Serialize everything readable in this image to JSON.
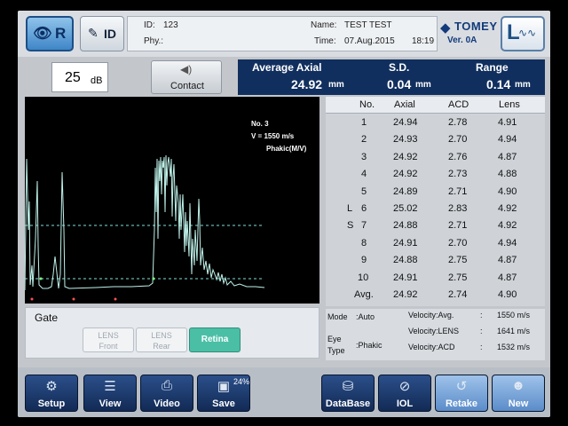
{
  "header": {
    "eye_side": "R",
    "id_button": "ID",
    "id_label": "ID:",
    "id_value": "123",
    "phy_label": "Phy.:",
    "phy_value": "",
    "name_label": "Name:",
    "name_value": "TEST TEST",
    "time_label": "Time:",
    "time_value": "07.Aug.2015",
    "time_clock": "18:19",
    "brand": "TOMEY",
    "version": "Ver. 0A",
    "lens_mode": "L"
  },
  "gain": {
    "value": "25",
    "unit": "dB"
  },
  "contact": {
    "label": "Contact"
  },
  "summary": {
    "avg_label": "Average Axial",
    "avg_value": "24.92",
    "avg_unit": "mm",
    "sd_label": "S.D.",
    "sd_value": "0.04",
    "sd_unit": "mm",
    "range_label": "Range",
    "range_value": "0.14",
    "range_unit": "mm"
  },
  "waveform_info": {
    "no": "No. 3",
    "velocity": "V = 1550 m/s",
    "phakic": "Phakic(M/V)"
  },
  "table": {
    "headers": [
      "No.",
      "Axial",
      "ACD",
      "Lens"
    ],
    "rows": [
      {
        "mark": "",
        "no": "1",
        "axial": "24.94",
        "acd": "2.78",
        "lens": "4.91"
      },
      {
        "mark": "",
        "no": "2",
        "axial": "24.93",
        "acd": "2.70",
        "lens": "4.94"
      },
      {
        "mark": "",
        "no": "3",
        "axial": "24.92",
        "acd": "2.76",
        "lens": "4.87"
      },
      {
        "mark": "",
        "no": "4",
        "axial": "24.92",
        "acd": "2.73",
        "lens": "4.88"
      },
      {
        "mark": "",
        "no": "5",
        "axial": "24.89",
        "acd": "2.71",
        "lens": "4.90"
      },
      {
        "mark": "L",
        "no": "6",
        "axial": "25.02",
        "acd": "2.83",
        "lens": "4.92"
      },
      {
        "mark": "S",
        "no": "7",
        "axial": "24.88",
        "acd": "2.71",
        "lens": "4.92"
      },
      {
        "mark": "",
        "no": "8",
        "axial": "24.91",
        "acd": "2.70",
        "lens": "4.94"
      },
      {
        "mark": "",
        "no": "9",
        "axial": "24.88",
        "acd": "2.75",
        "lens": "4.87"
      },
      {
        "mark": "",
        "no": "10",
        "axial": "24.91",
        "acd": "2.75",
        "lens": "4.87"
      },
      {
        "mark": "",
        "no": "Avg.",
        "axial": "24.92",
        "acd": "2.74",
        "lens": "4.90"
      }
    ]
  },
  "gate": {
    "title": "Gate",
    "buttons": [
      {
        "line1": "LENS",
        "line2": "Front"
      },
      {
        "line1": "LENS",
        "line2": "Rear"
      },
      {
        "line1": "Retina",
        "line2": ""
      }
    ]
  },
  "velocity": {
    "mode_label": "Mode",
    "mode_value": ":Auto",
    "eye_label1": "Eye",
    "eye_label2": "Type",
    "eye_value": ":Phakic",
    "rows": [
      {
        "label": "Velocity:Avg.",
        "colon": ":",
        "value": "1550 m/s"
      },
      {
        "label": "Velocity:LENS",
        "colon": ":",
        "value": "1641 m/s"
      },
      {
        "label": "Velocity:ACD",
        "colon": ":",
        "value": "1532 m/s"
      }
    ]
  },
  "toolbar": {
    "setup": "Setup",
    "view": "View",
    "video": "Video",
    "save": "Save",
    "save_pct": "24%",
    "database": "DataBase",
    "iol": "IOL",
    "retake": "Retake",
    "new": "New"
  }
}
